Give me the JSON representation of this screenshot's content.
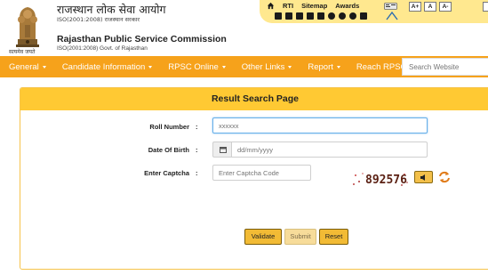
{
  "header": {
    "hindi_title": "राजस्थान लोक सेवा आयोग",
    "hindi_iso": "ISO(2001:2008) राजस्थान सरकार",
    "english_title": "Rajasthan Public Service Commission",
    "english_iso": "ISO(2001:2008) Govt. of Rajasthan",
    "motto": "सत्यमेव जयते"
  },
  "topbar": {
    "links": [
      "RTI",
      "Sitemap",
      "Awards"
    ],
    "font_buttons": [
      "A+",
      "A",
      "A-"
    ],
    "social_icons": [
      "facebook-icon",
      "twitter-icon",
      "instagram-icon",
      "calendar-icon",
      "youtube-icon",
      "mail-icon",
      "rss-icon",
      "globe-icon",
      "pin-icon"
    ]
  },
  "nav": {
    "items": [
      "General",
      "Candidate Information",
      "RPSC Online",
      "Other Links",
      "Report",
      "Reach RPSC"
    ],
    "search_placeholder": "Search Website"
  },
  "form": {
    "title": "Result Search Page",
    "roll_label": "Roll Number",
    "roll_placeholder": "xxxxxx",
    "dob_label": "Date Of Birth",
    "dob_placeholder": "dd/mm/yyyy",
    "captcha_label": "Enter Captcha",
    "captcha_placeholder": "Enter Captcha Code",
    "captcha_text": "892576",
    "colon": ":",
    "buttons": {
      "validate": "Validate",
      "submit": "Submit",
      "reset": "Reset"
    }
  },
  "colors": {
    "nav_bg": "#f6a21b",
    "panel_head": "#ffc933",
    "topbar_bg": "#ffe88f",
    "button_bg": "#f2bb35"
  }
}
